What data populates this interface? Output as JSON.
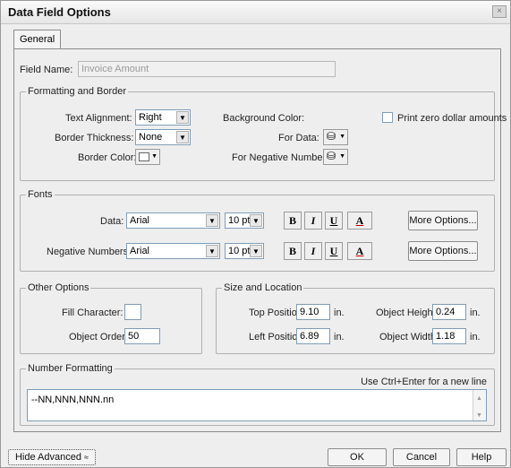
{
  "window": {
    "title": "Data Field Options",
    "close_glyph": "×"
  },
  "tabs": [
    {
      "label": "General"
    }
  ],
  "field_name": {
    "label": "Field Name:",
    "value": "Invoice Amount"
  },
  "formatting_border": {
    "title": "Formatting and Border",
    "text_alignment": {
      "label": "Text Alignment:",
      "value": "Right"
    },
    "border_thickness": {
      "label": "Border Thickness:",
      "value": "None"
    },
    "border_color": {
      "label": "Border Color:"
    },
    "background_color": {
      "label": "Background Color:"
    },
    "for_data": {
      "label": "For Data:"
    },
    "for_negative_numbers": {
      "label": "For Negative Numbers:"
    },
    "print_zero": {
      "label": "Print zero dollar amounts",
      "checked": false
    }
  },
  "fonts": {
    "title": "Fonts",
    "data": {
      "label": "Data:",
      "font": "Arial",
      "size": "10 pt"
    },
    "negative": {
      "label": "Negative Numbers:",
      "font": "Arial",
      "size": "10 pt"
    },
    "bold": "B",
    "italic": "I",
    "underline": "U",
    "color": "A",
    "more_options": "More Options..."
  },
  "other_options": {
    "title": "Other Options",
    "fill_character": {
      "label": "Fill Character:",
      "value": ""
    },
    "object_order": {
      "label": "Object Order:",
      "value": "50"
    }
  },
  "size_location": {
    "title": "Size and Location",
    "top": {
      "label": "Top Position:",
      "value": "9.10",
      "unit": "in."
    },
    "left": {
      "label": "Left Position:",
      "value": "6.89",
      "unit": "in."
    },
    "height": {
      "label": "Object Height:",
      "value": "0.24",
      "unit": "in."
    },
    "width": {
      "label": "Object Width:",
      "value": "1.18",
      "unit": "in."
    }
  },
  "number_formatting": {
    "title": "Number Formatting",
    "hint": "Use Ctrl+Enter for a new line",
    "value": "--NN,NNN,NNN.nn"
  },
  "footer": {
    "hide_advanced": "Hide Advanced",
    "hide_advanced_icon": "double-chevron-up",
    "ok": "OK",
    "cancel": "Cancel",
    "help": "Help"
  }
}
